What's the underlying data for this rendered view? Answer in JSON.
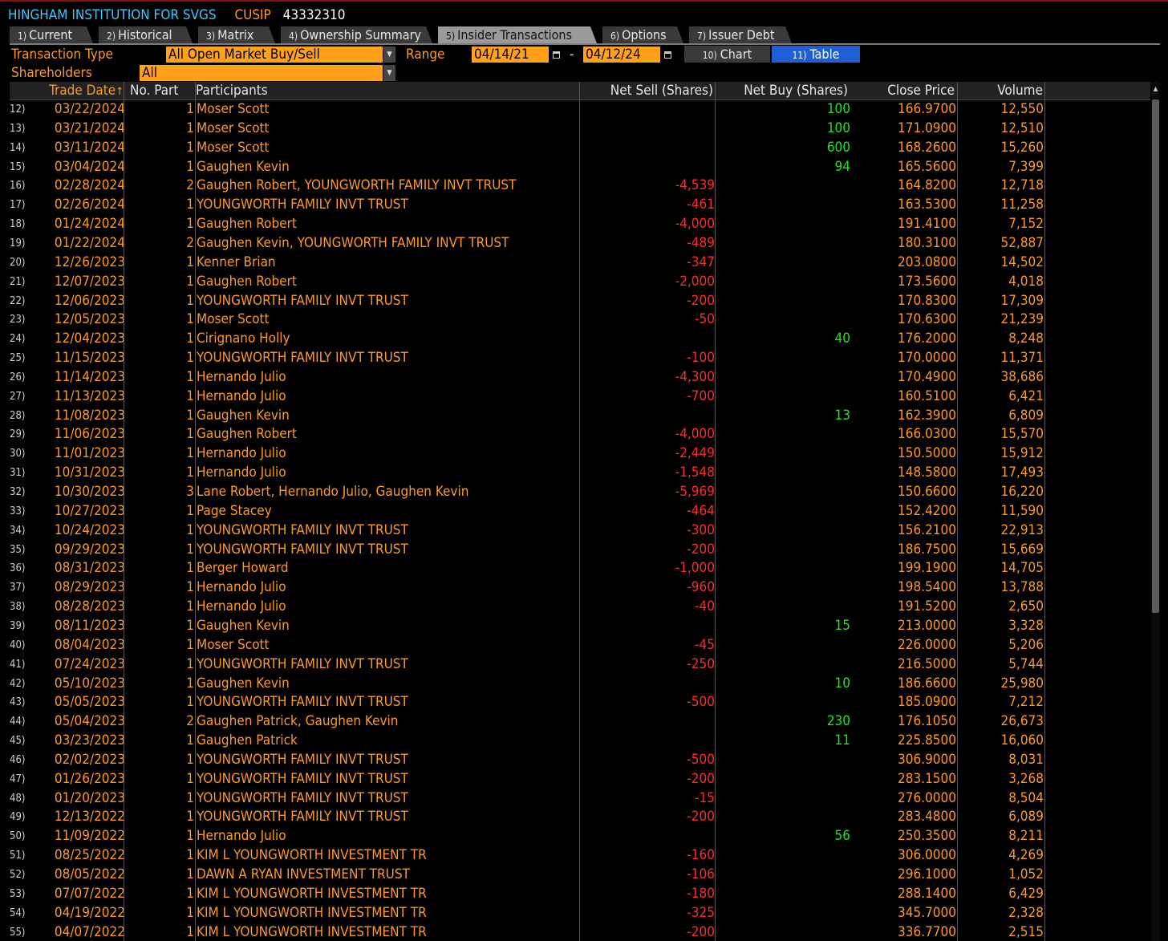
{
  "title": {
    "security": "HINGHAM INSTITUTION FOR SVGS",
    "cusip_label": "CUSIP",
    "cusip_value": "43332310"
  },
  "tabs": [
    {
      "num": "1)",
      "label": "Current",
      "active": false
    },
    {
      "num": "2)",
      "label": "Historical",
      "active": false
    },
    {
      "num": "3)",
      "label": "Matrix",
      "active": false
    },
    {
      "num": "4)",
      "label": "Ownership Summary",
      "active": false
    },
    {
      "num": "5)",
      "label": "Insider Transactions",
      "active": true
    },
    {
      "num": "6)",
      "label": "Options",
      "active": false
    },
    {
      "num": "7)",
      "label": "Issuer Debt",
      "active": false
    }
  ],
  "filters": {
    "transaction_type_label": "Transaction Type",
    "transaction_type_value": "All Open Market Buy/Sell",
    "range_label": "Range",
    "range_start": "04/14/21",
    "range_sep": "-",
    "range_end": "04/12/24",
    "shareholders_label": "Shareholders",
    "shareholders_value": "All",
    "chart_btn": {
      "num": "10)",
      "label": "Chart"
    },
    "table_btn": {
      "num": "11)",
      "label": "Table"
    }
  },
  "colors": {
    "accent": "#ff9a1f",
    "sell": "#ff2a2a",
    "buy": "#20e620",
    "title": "#3cc8ff",
    "table_btn": "#1f5fd6"
  },
  "columns": [
    "Trade Date",
    "No. Part",
    "Participants",
    "Net Sell (Shares)",
    "Net Buy (Shares)",
    "Close Price",
    "Volume"
  ],
  "rows": [
    [
      "12)",
      "03/22/2024",
      "1",
      "Moser Scott",
      "",
      "100",
      "166.9700",
      "12,550"
    ],
    [
      "13)",
      "03/21/2024",
      "1",
      "Moser Scott",
      "",
      "100",
      "171.0900",
      "12,510"
    ],
    [
      "14)",
      "03/11/2024",
      "1",
      "Moser Scott",
      "",
      "600",
      "168.2600",
      "15,260"
    ],
    [
      "15)",
      "03/04/2024",
      "1",
      "Gaughen Kevin",
      "",
      "94",
      "165.5600",
      "7,399"
    ],
    [
      "16)",
      "02/28/2024",
      "2",
      "Gaughen Robert, YOUNGWORTH FAMILY INVT TRUST",
      "-4,539",
      "",
      "164.8200",
      "12,718"
    ],
    [
      "17)",
      "02/26/2024",
      "1",
      "YOUNGWORTH FAMILY INVT TRUST",
      "-461",
      "",
      "163.5300",
      "11,258"
    ],
    [
      "18)",
      "01/24/2024",
      "1",
      "Gaughen Robert",
      "-4,000",
      "",
      "191.4100",
      "7,152"
    ],
    [
      "19)",
      "01/22/2024",
      "2",
      "Gaughen Kevin, YOUNGWORTH FAMILY INVT TRUST",
      "-489",
      "",
      "180.3100",
      "52,887"
    ],
    [
      "20)",
      "12/26/2023",
      "1",
      "Kenner Brian",
      "-347",
      "",
      "203.0800",
      "14,502"
    ],
    [
      "21)",
      "12/07/2023",
      "1",
      "Gaughen Robert",
      "-2,000",
      "",
      "173.5600",
      "4,018"
    ],
    [
      "22)",
      "12/06/2023",
      "1",
      "YOUNGWORTH FAMILY INVT TRUST",
      "-200",
      "",
      "170.8300",
      "17,309"
    ],
    [
      "23)",
      "12/05/2023",
      "1",
      "Moser Scott",
      "-50",
      "",
      "170.6300",
      "21,239"
    ],
    [
      "24)",
      "12/04/2023",
      "1",
      "Cirignano Holly",
      "",
      "40",
      "176.2000",
      "8,248"
    ],
    [
      "25)",
      "11/15/2023",
      "1",
      "YOUNGWORTH FAMILY INVT TRUST",
      "-100",
      "",
      "170.0000",
      "11,371"
    ],
    [
      "26)",
      "11/14/2023",
      "1",
      "Hernando Julio",
      "-4,300",
      "",
      "170.4900",
      "38,686"
    ],
    [
      "27)",
      "11/13/2023",
      "1",
      "Hernando Julio",
      "-700",
      "",
      "160.5100",
      "6,421"
    ],
    [
      "28)",
      "11/08/2023",
      "1",
      "Gaughen Kevin",
      "",
      "13",
      "162.3900",
      "6,809"
    ],
    [
      "29)",
      "11/06/2023",
      "1",
      "Gaughen Robert",
      "-4,000",
      "",
      "166.0300",
      "15,570"
    ],
    [
      "30)",
      "11/01/2023",
      "1",
      "Hernando Julio",
      "-2,449",
      "",
      "150.5000",
      "15,912"
    ],
    [
      "31)",
      "10/31/2023",
      "1",
      "Hernando Julio",
      "-1,548",
      "",
      "148.5800",
      "17,493"
    ],
    [
      "32)",
      "10/30/2023",
      "3",
      "Lane Robert, Hernando Julio, Gaughen Kevin",
      "-5,969",
      "",
      "150.6600",
      "16,220"
    ],
    [
      "33)",
      "10/27/2023",
      "1",
      "Page Stacey",
      "-464",
      "",
      "152.4200",
      "11,590"
    ],
    [
      "34)",
      "10/24/2023",
      "1",
      "YOUNGWORTH FAMILY INVT TRUST",
      "-300",
      "",
      "156.2100",
      "22,913"
    ],
    [
      "35)",
      "09/29/2023",
      "1",
      "YOUNGWORTH FAMILY INVT TRUST",
      "-200",
      "",
      "186.7500",
      "15,669"
    ],
    [
      "36)",
      "08/31/2023",
      "1",
      "Berger Howard",
      "-1,000",
      "",
      "199.1900",
      "14,705"
    ],
    [
      "37)",
      "08/29/2023",
      "1",
      "Hernando Julio",
      "-960",
      "",
      "198.5400",
      "13,788"
    ],
    [
      "38)",
      "08/28/2023",
      "1",
      "Hernando Julio",
      "-40",
      "",
      "191.5200",
      "2,650"
    ],
    [
      "39)",
      "08/11/2023",
      "1",
      "Gaughen Kevin",
      "",
      "15",
      "213.0000",
      "3,328"
    ],
    [
      "40)",
      "08/04/2023",
      "1",
      "Moser Scott",
      "-45",
      "",
      "226.0000",
      "5,206"
    ],
    [
      "41)",
      "07/24/2023",
      "1",
      "YOUNGWORTH FAMILY INVT TRUST",
      "-250",
      "",
      "216.5000",
      "5,744"
    ],
    [
      "42)",
      "05/10/2023",
      "1",
      "Gaughen Kevin",
      "",
      "10",
      "186.6600",
      "25,980"
    ],
    [
      "43)",
      "05/05/2023",
      "1",
      "YOUNGWORTH FAMILY INVT TRUST",
      "-500",
      "",
      "185.0900",
      "7,212"
    ],
    [
      "44)",
      "05/04/2023",
      "2",
      "Gaughen Patrick, Gaughen Kevin",
      "",
      "230",
      "176.1050",
      "26,673"
    ],
    [
      "45)",
      "03/23/2023",
      "1",
      "Gaughen Patrick",
      "",
      "11",
      "225.8500",
      "16,060"
    ],
    [
      "46)",
      "02/02/2023",
      "1",
      "YOUNGWORTH FAMILY INVT TRUST",
      "-500",
      "",
      "306.9000",
      "8,031"
    ],
    [
      "47)",
      "01/26/2023",
      "1",
      "YOUNGWORTH FAMILY INVT TRUST",
      "-200",
      "",
      "283.1500",
      "3,268"
    ],
    [
      "48)",
      "01/20/2023",
      "1",
      "YOUNGWORTH FAMILY INVT TRUST",
      "-15",
      "",
      "276.0000",
      "8,504"
    ],
    [
      "49)",
      "12/13/2022",
      "1",
      "YOUNGWORTH FAMILY INVT TRUST",
      "-200",
      "",
      "283.4800",
      "6,089"
    ],
    [
      "50)",
      "11/09/2022",
      "1",
      "Hernando Julio",
      "",
      "56",
      "250.3500",
      "8,211"
    ],
    [
      "51)",
      "08/25/2022",
      "1",
      "KIM L YOUNGWORTH INVESTMENT TR",
      "-160",
      "",
      "306.0000",
      "4,269"
    ],
    [
      "52)",
      "08/05/2022",
      "1",
      "DAWN A RYAN INVESTMENT TRUST",
      "-106",
      "",
      "296.1000",
      "1,052"
    ],
    [
      "53)",
      "07/07/2022",
      "1",
      "KIM L YOUNGWORTH INVESTMENT TR",
      "-180",
      "",
      "288.1400",
      "6,429"
    ],
    [
      "54)",
      "04/19/2022",
      "1",
      "KIM L YOUNGWORTH INVESTMENT TR",
      "-325",
      "",
      "345.7000",
      "2,328"
    ],
    [
      "55)",
      "04/07/2022",
      "1",
      "KIM L YOUNGWORTH INVESTMENT TR",
      "-200",
      "",
      "336.7700",
      "2,515"
    ]
  ]
}
